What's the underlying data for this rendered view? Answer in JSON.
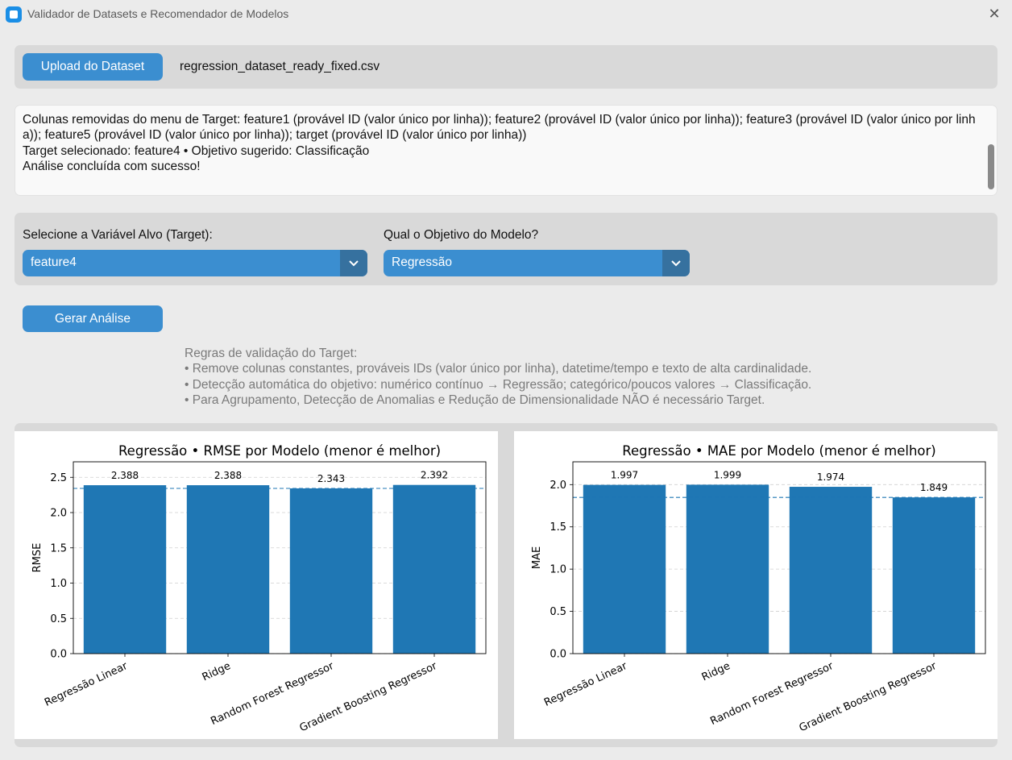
{
  "window": {
    "title": "Validador de Datasets e Recomendador de Modelos"
  },
  "upload": {
    "button_label": "Upload do Dataset",
    "filename": "regression_dataset_ready_fixed.csv"
  },
  "log": {
    "text": "Colunas removidas do menu de Target: feature1 (provável ID (valor único por linha)); feature2 (provável ID (valor único por linha)); feature3 (provável ID (valor único por linha)); feature5 (provável ID (valor único por linha)); target (provável ID (valor único por linha))\nTarget selecionado: feature4 • Objetivo sugerido: Classificação\nAnálise concluída com sucesso!"
  },
  "target": {
    "label": "Selecione a Variável Alvo (Target):",
    "value": "feature4"
  },
  "objective": {
    "label": "Qual o Objetivo do Modelo?",
    "value": "Regressão"
  },
  "analysis": {
    "button_label": "Gerar Análise"
  },
  "rules": {
    "title": "Regras de validação do Target:",
    "items": [
      "• Remove colunas constantes, prováveis IDs (valor único por linha), datetime/tempo e texto de alta cardinalidade.",
      "• Detecção automática do objetivo: numérico contínuo → Regressão; categórico/poucos valores → Classificação.",
      "• Para Agrupamento, Detecção de Anomalias e Redução de Dimensionalidade NÃO é necessário Target."
    ]
  },
  "colors": {
    "bar": "#1f77b4",
    "button": "#3b8ed0",
    "dropdown_arrow_bg": "#36719f"
  },
  "chart_data": [
    {
      "type": "bar",
      "title": "Regressão • RMSE por Modelo (menor é melhor)",
      "xlabel": "",
      "ylabel": "RMSE",
      "categories": [
        "Regressão Linear",
        "Ridge",
        "Random Forest Regressor",
        "Gradient Boosting Regressor"
      ],
      "values": [
        2.388,
        2.388,
        2.343,
        2.392
      ],
      "value_labels": [
        "2.388",
        "2.388",
        "2.343",
        "2.392"
      ],
      "reference_line": 2.343,
      "ylim": [
        0,
        2.72
      ],
      "yticks": [
        "0.0",
        "0.5",
        "1.0",
        "1.5",
        "2.0",
        "2.5"
      ],
      "grid": "y-dashed"
    },
    {
      "type": "bar",
      "title": "Regressão • MAE por Modelo (menor é melhor)",
      "xlabel": "",
      "ylabel": "MAE",
      "categories": [
        "Regressão Linear",
        "Ridge",
        "Random Forest Regressor",
        "Gradient Boosting Regressor"
      ],
      "values": [
        1.997,
        1.999,
        1.974,
        1.849
      ],
      "value_labels": [
        "1.997",
        "1.999",
        "1.974",
        "1.849"
      ],
      "reference_line": 1.849,
      "ylim": [
        0,
        2.27
      ],
      "yticks": [
        "0.0",
        "0.5",
        "1.0",
        "1.5",
        "2.0"
      ],
      "grid": "y-dashed"
    }
  ]
}
